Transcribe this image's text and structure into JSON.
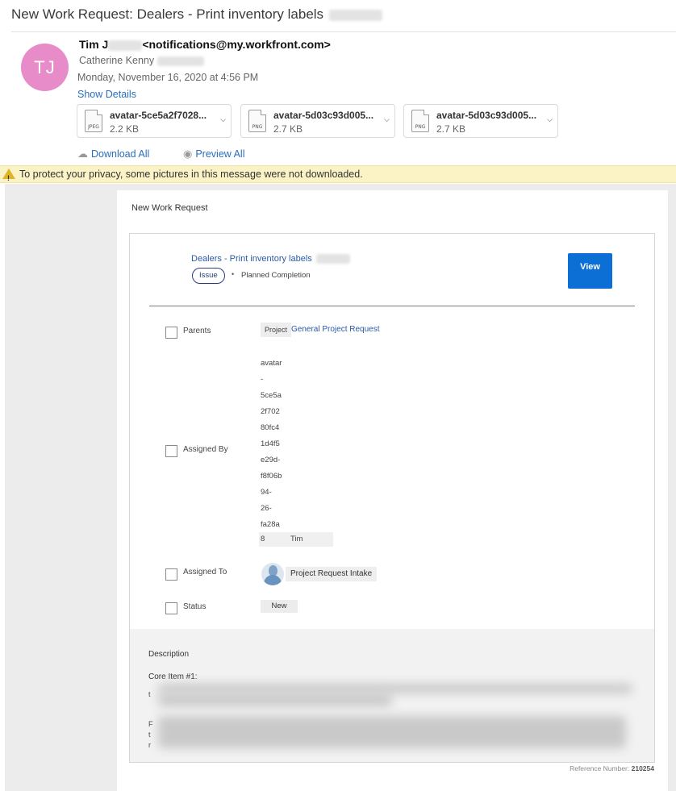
{
  "email": {
    "subject": "New Work Request: Dealers - Print inventory labels",
    "sender_name": "Tim J",
    "sender_address": "<notifications@my.workfront.com>",
    "avatar_initials": "TJ",
    "avatar_color": "#e88bc9",
    "recipient": "Catherine Kenny",
    "date": "Monday, November 16, 2020 at 4:56 PM",
    "show_details": "Show Details"
  },
  "attachments": [
    {
      "name": "avatar-5ce5a2f7028...",
      "size": "2.2 KB",
      "ext": "JPEG"
    },
    {
      "name": "avatar-5d03c93d005...",
      "size": "2.7 KB",
      "ext": "PNG"
    },
    {
      "name": "avatar-5d03c93d005...",
      "size": "2.7 KB",
      "ext": "PNG"
    }
  ],
  "actions": {
    "download_all": "Download All",
    "preview_all": "Preview All"
  },
  "privacy_notice": "To protect your privacy, some pictures in this message were not downloaded.",
  "body": {
    "header": "New Work Request",
    "task_title": "Dealers - Print inventory labels",
    "badge": "Issue",
    "bullet": "•",
    "planned": "Planned Completion",
    "view_label": "View",
    "view_color": "#0c6fd6",
    "fields": {
      "parents_label": "Parents",
      "parents_tag": "Project",
      "parents_value": "General Project Request",
      "assigned_by_label": "Assigned By",
      "assigned_by_lines": [
        "avatar",
        "-",
        "5ce5a",
        "2f702",
        "80fc4",
        "1d4f5",
        "e29d-",
        "f8f06b",
        "94-",
        "26-",
        "fa28a"
      ],
      "assigned_by_last_prefix": "8",
      "assigned_by_last_name": "Tim",
      "assigned_to_label": "Assigned To",
      "assigned_to_value": "Project Request Intake",
      "status_label": "Status",
      "status_value": "New"
    },
    "description": {
      "label": "Description",
      "core_item": "Core Item #1:",
      "fragments": [
        "t",
        "F",
        "t",
        "r"
      ]
    },
    "reference_label": "Reference Number:",
    "reference_number": "210254"
  }
}
